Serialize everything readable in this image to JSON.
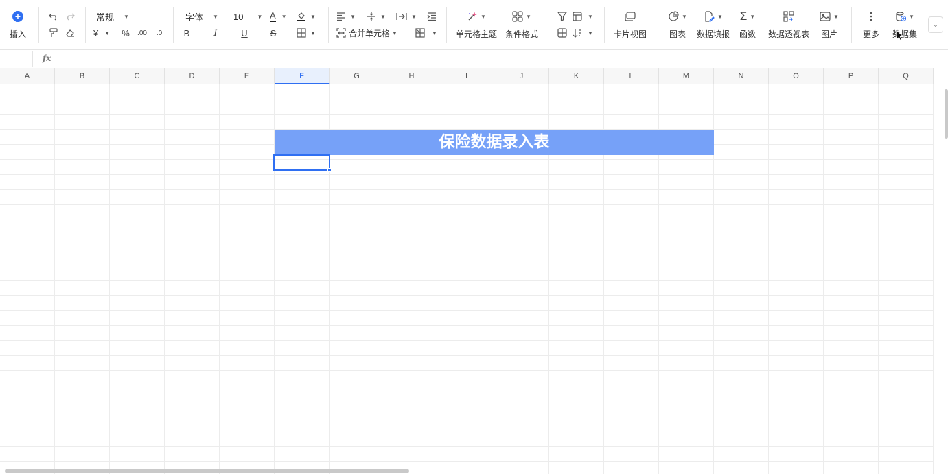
{
  "toolbar": {
    "insert_label": "插入",
    "number_format": "常规",
    "font_name": "字体",
    "font_size": "10",
    "merge_label": "合并单元格",
    "cell_theme_label": "单元格主题",
    "cond_format_label": "条件格式",
    "card_view_label": "卡片视图",
    "chart_label": "图表",
    "data_fill_label": "数据填报",
    "function_label": "函数",
    "pivot_label": "数据透视表",
    "image_label": "图片",
    "more_label": "更多",
    "dataset_label": "数据集",
    "currency_symbol": "¥",
    "percent_symbol": "%",
    "decimal_inc": ".00",
    "decimal_dec": ".0",
    "bold": "B",
    "italic": "I",
    "underline": "U",
    "strike": "S",
    "font_color_glyph": "A",
    "function_glyph": "Σ"
  },
  "formula_bar": {
    "fx_label": "fx"
  },
  "columns": [
    "A",
    "B",
    "C",
    "D",
    "E",
    "F",
    "G",
    "H",
    "I",
    "J",
    "K",
    "L",
    "M",
    "N",
    "O",
    "P",
    "Q"
  ],
  "selected_column": "F",
  "sheet": {
    "title_text": "保险数据录入表"
  },
  "colors": {
    "accent": "#2f6ff2",
    "title_fill": "#76a1f8"
  }
}
